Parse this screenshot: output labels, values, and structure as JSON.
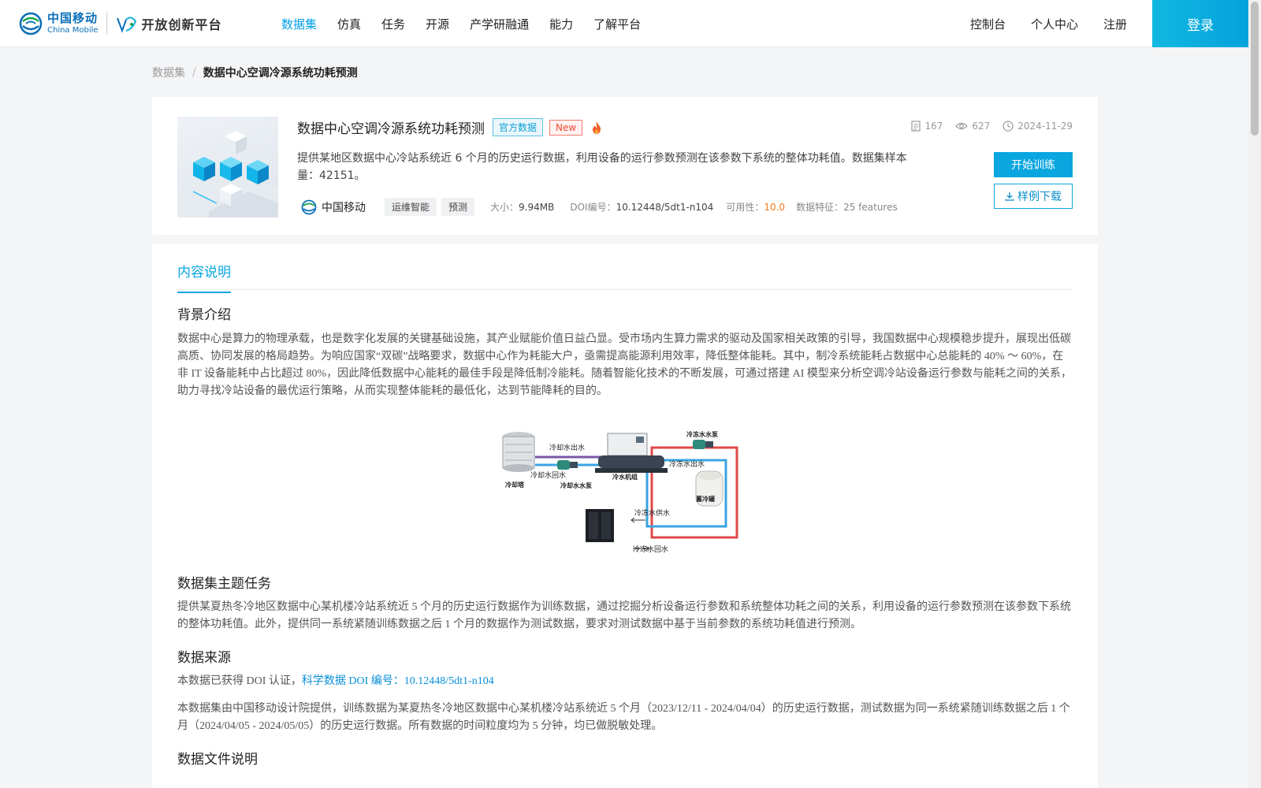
{
  "header": {
    "logo_cn": "中国移动",
    "logo_en": "China Mobile",
    "platform_name": "开放创新平台",
    "nav": [
      "数据集",
      "仿真",
      "任务",
      "开源",
      "产学研融通",
      "能力",
      "了解平台"
    ],
    "right_links": [
      "控制台",
      "个人中心",
      "注册"
    ],
    "login_label": "登录",
    "colors": {
      "accent": "#00a0e9",
      "brand": "#0a6fb8"
    }
  },
  "breadcrumb": {
    "root": "数据集",
    "separator": "/",
    "current": "数据中心空调冷源系统功耗预测"
  },
  "dataset": {
    "title": "数据中心空调冷源系统功耗预测",
    "tag_official": "官方数据",
    "tag_new": "New",
    "description": "提供某地区数据中心冷站系统近 6 个月的历史运行数据，利用设备的运行参数预测在该参数下系统的整体功耗值。数据集样本量：42151。",
    "provider": "中国移动",
    "chips": [
      "运维智能",
      "预测"
    ],
    "size_label": "大小：",
    "size_value": "9.94MB",
    "doi_label": "DOI编号：",
    "doi_value": "10.12448/5dt1-n104",
    "usability_label": "可用性：",
    "usability_value": "10.0",
    "features_label": "数据特征：",
    "features_value": "25 features",
    "stats": {
      "downloads": "167",
      "views": "627",
      "date": "2024-11-29"
    },
    "btn_train": "开始训练",
    "btn_sample": "样例下载"
  },
  "content": {
    "tab": "内容说明",
    "sections": {
      "background_title": "背景介绍",
      "background_text": "数据中心是算力的物理承载，也是数字化发展的关键基础设施，其产业赋能价值日益凸显。受市场内生算力需求的驱动及国家相关政策的引导，我国数据中心规模稳步提升，展现出低碳高质、协同发展的格局趋势。为响应国家“双碳”战略要求，数据中心作为耗能大户，亟需提高能源利用效率，降低整体能耗。其中，制冷系统能耗占数据中心总能耗的 40% ～ 60%，在非 IT 设备能耗中占比超过 80%，因此降低数据中心能耗的最佳手段是降低制冷能耗。随着智能化技术的不断发展，可通过搭建 AI 模型来分析空调冷站设备运行参数与能耗之间的关系，助力寻找冷站设备的最优运行策略，从而实现整体能耗的最低化，达到节能降耗的目的。",
      "task_title": "数据集主题任务",
      "task_text": "提供某夏热冬冷地区数据中心某机楼冷站系统近 5 个月的历史运行数据作为训练数据，通过挖掘分析设备运行参数和系统整体功耗之间的关系，利用设备的运行参数预测在该参数下系统的整体功耗值。此外，提供同一系统紧随训练数据之后 1 个月的数据作为测试数据，要求对测试数据中基于当前参数的系统功耗值进行预测。",
      "source_title": "数据来源",
      "source_text1_prefix": "本数据已获得 DOI 认证，",
      "source_link": "科学数据 DOI 编号：10.12448/5dt1-n104",
      "source_text2": "本数据集由中国移动设计院提供，训练数据为某夏热冬冷地区数据中心某机楼冷站系统近 5 个月（2023/12/11 - 2024/04/04）的历史运行数据，测试数据为同一系统紧随训练数据之后 1 个月（2024/04/05 - 2024/05/05）的历史运行数据。所有数据的时间粒度均为 5 分钟，均已做脱敏处理。",
      "files_title": "数据文件说明"
    },
    "diagram_labels": {
      "cooling_tower": "冷却塔",
      "cooling_out": "冷却水出水",
      "cooling_return": "冷却水回水",
      "cooling_pump": "冷却水水泵",
      "chiller": "冷水机组",
      "chilled_pump": "冷冻水水泵",
      "chilled_out": "冷冻水出水",
      "storage": "蓄冷罐",
      "chilled_supply": "冷冻水供水",
      "chilled_return": "冷冻水回水"
    }
  }
}
